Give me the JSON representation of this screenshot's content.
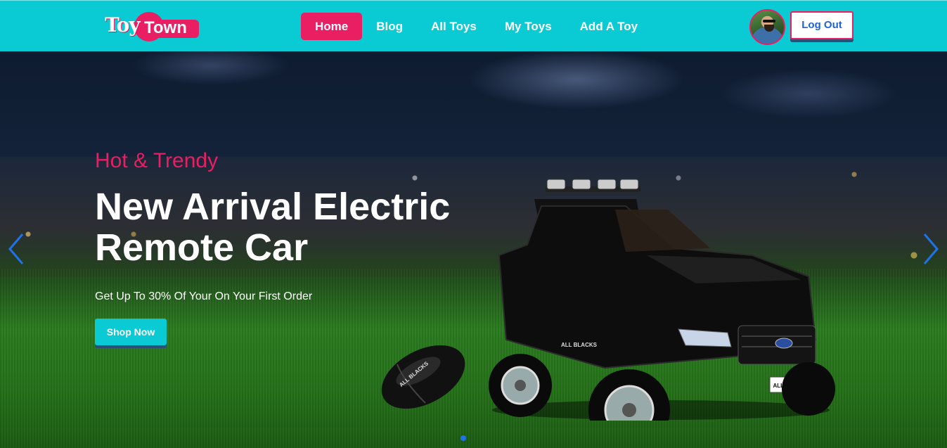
{
  "brand": {
    "part1": "Toy",
    "part2": "Town"
  },
  "nav": {
    "items": [
      {
        "label": "Home",
        "active": true
      },
      {
        "label": "Blog",
        "active": false
      },
      {
        "label": "All Toys",
        "active": false
      },
      {
        "label": "My Toys",
        "active": false
      },
      {
        "label": "Add A Toy",
        "active": false
      }
    ]
  },
  "user": {
    "logout_label": "Log Out"
  },
  "hero": {
    "subtitle": "Hot & Trendy",
    "headline": "New Arrival Electric Remote Car",
    "tagline": "Get Up To 30% Of Your On Your First Order",
    "cta_label": "Shop Now",
    "car_plate": "ALL BLACKS",
    "car_door_text": "ALL BLACKS",
    "ball_text": "ALL BLACKS"
  },
  "carousel": {
    "slide_count": 1,
    "active_slide": 1
  },
  "colors": {
    "nav_bg": "#0acbd3",
    "accent": "#e91e63",
    "button_shadow": "#2c4f78",
    "logout_text": "#1e63d6",
    "carousel_arrow": "#1e73e8"
  }
}
